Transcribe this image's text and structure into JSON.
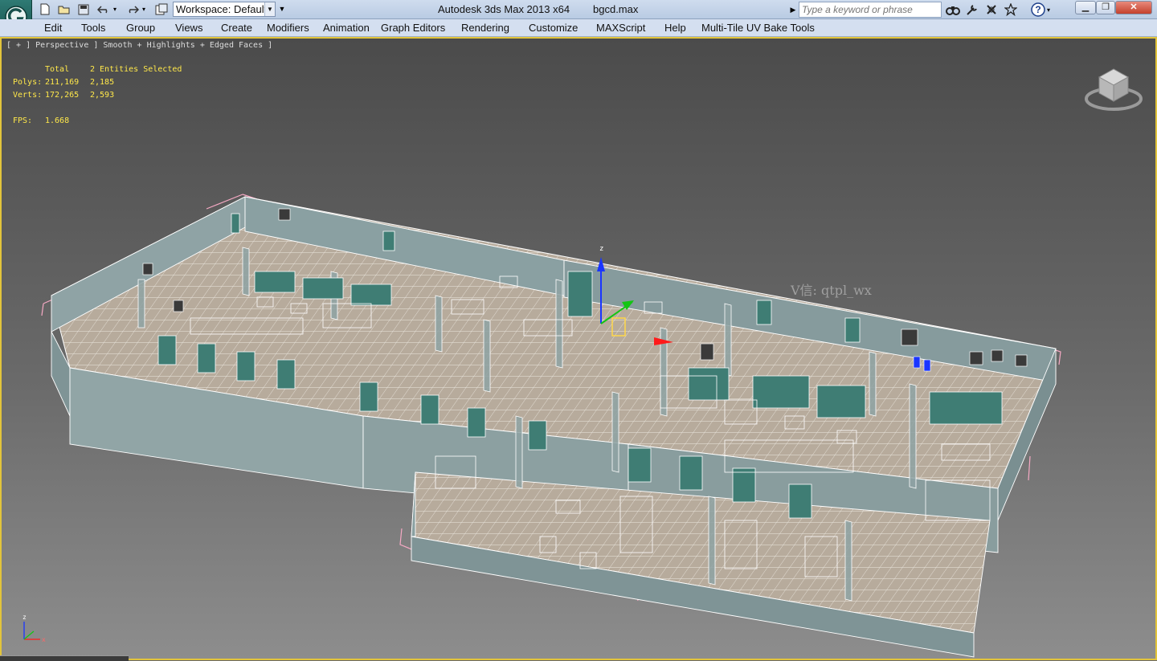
{
  "titlebar": {
    "workspace": "Workspace: Default",
    "app_title": "Autodesk 3ds Max  2013 x64",
    "file_name": "bgcd.max",
    "search_placeholder": "Type a keyword or phrase",
    "help_label": "?"
  },
  "menu": [
    "Edit",
    "Tools",
    "Group",
    "Views",
    "Create",
    "Modifiers",
    "Animation",
    "Graph Editors",
    "Rendering",
    "Customize",
    "MAXScript",
    "Help",
    "Multi-Tile UV Bake Tools"
  ],
  "viewport": {
    "label": "[ + ] Perspective ] Smooth + Highlights + Edged Faces ]",
    "stats": {
      "header_total": "Total",
      "header_selected": "2 Entities Selected",
      "polys_label": "Polys:",
      "polys_total": "211,169",
      "polys_selected": "2,185",
      "verts_label": "Verts:",
      "verts_total": "172,265",
      "verts_selected": "2,593",
      "fps_label": "FPS:",
      "fps_value": "1.668"
    },
    "watermark": "V信: qtpl_wx",
    "gizmo_axes": {
      "z": "z",
      "x": "x"
    },
    "move_gizmo_axis": "z"
  },
  "colors": {
    "viewport_border": "#e2c43b",
    "stats_text": "#ffe84a",
    "wall": "#8fa3a5",
    "floor": "#b5a99a",
    "window_glass": "#3f7d74",
    "edges": "#ffffff",
    "selection_bracket": "#f6a9c4",
    "gizmo_z": "#1a35ff",
    "gizmo_x": "#ff1a1a",
    "gizmo_y": "#13c513"
  },
  "icons": [
    "app-logo-icon",
    "new-file-icon",
    "open-file-icon",
    "save-icon",
    "undo-icon",
    "redo-icon",
    "project-folder-icon",
    "binoculars-icon",
    "tools-icon",
    "communication-icon",
    "favorites-star-icon",
    "help-icon",
    "minimize-icon",
    "restore-icon",
    "close-icon",
    "viewcube-icon",
    "axis-tripod-icon"
  ]
}
